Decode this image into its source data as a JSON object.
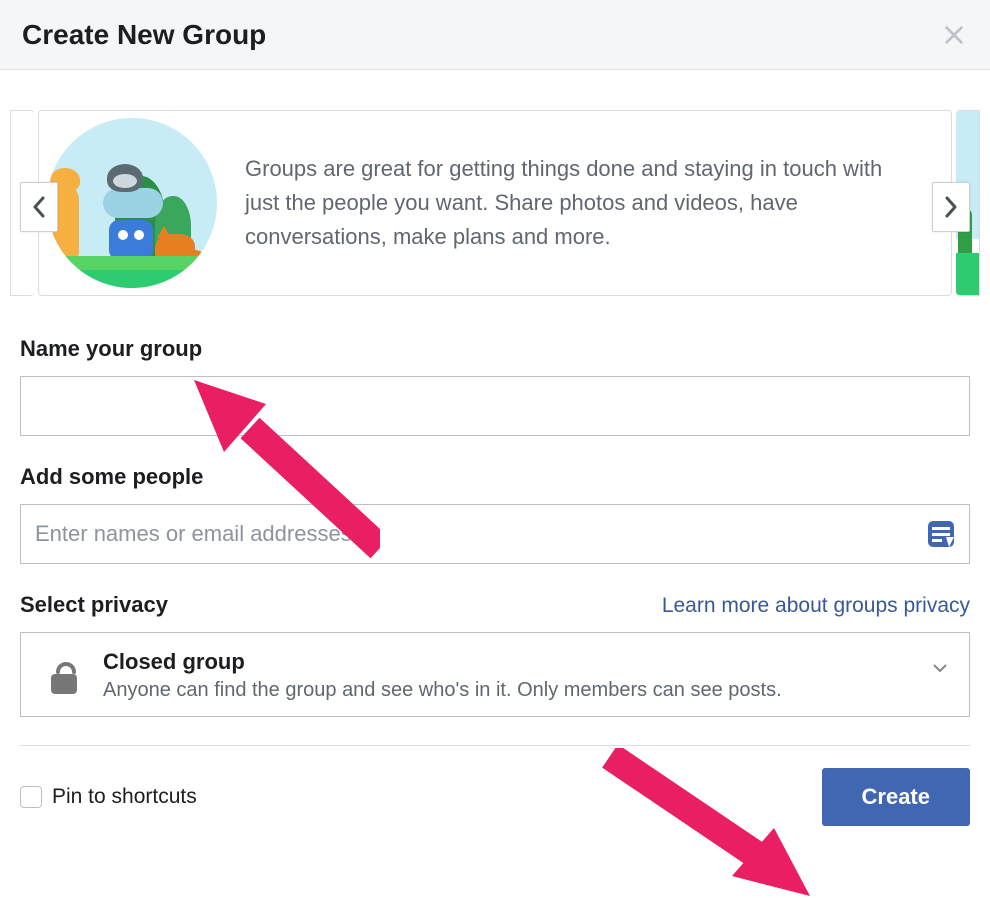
{
  "dialog": {
    "title": "Create New Group"
  },
  "carousel": {
    "text": "Groups are great for getting things done and staying in touch with just the people you want. Share photos and videos, have conversations, make plans and more."
  },
  "form": {
    "name_label": "Name your group",
    "name_value": "",
    "people_label": "Add some people",
    "people_placeholder": "Enter names or email addresses...",
    "people_value": ""
  },
  "privacy": {
    "section_label": "Select privacy",
    "learn_link": "Learn more about groups privacy",
    "selected": {
      "title": "Closed group",
      "description": "Anyone can find the group and see who's in it. Only members can see posts."
    }
  },
  "footer": {
    "pin_label": "Pin to shortcuts",
    "pin_checked": false,
    "create_label": "Create"
  },
  "colors": {
    "brand": "#4267b2",
    "link": "#385898",
    "annotation": "#e91e63"
  }
}
